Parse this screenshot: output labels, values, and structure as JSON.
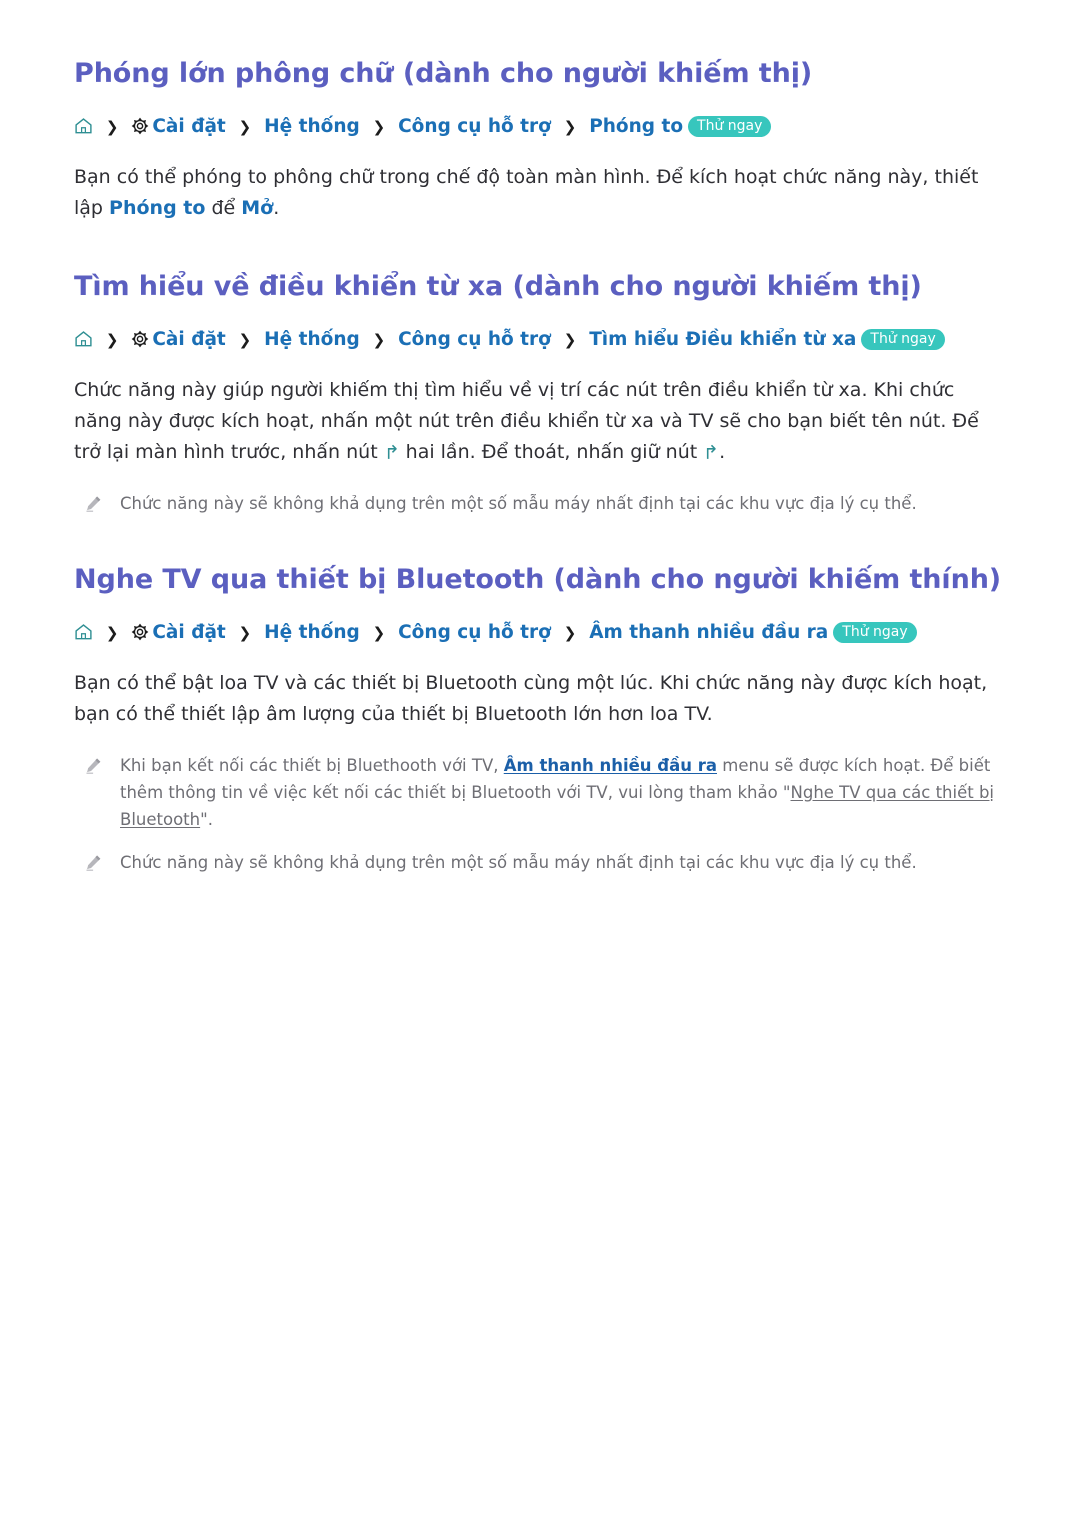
{
  "document": {
    "language": "vi",
    "accent_heading_color": "#5b5fc0",
    "link_color": "#1b6fb5",
    "badge_color": "#37c6bd",
    "note_text_color": "#6e6e74"
  },
  "sections": [
    {
      "id": "zoom-font",
      "title": "Phóng lớn phông chữ (dành cho người khiếm thị)",
      "breadcrumb": {
        "home_icon": "home-icon",
        "gear_icon": "gear-icon",
        "separator": "❯",
        "crumbs": [
          "Cài đặt",
          "Hệ thống",
          "Công cụ hỗ trợ",
          "Phóng to"
        ],
        "badge": "Thử ngay"
      },
      "body": {
        "part1": "Bạn có thể phóng to phông chữ trong chế độ toàn màn hình. Để kích hoạt chức năng này, thiết lập ",
        "link1": "Phóng to",
        "part2": " để ",
        "link2": "Mở",
        "part3": "."
      },
      "notes": []
    },
    {
      "id": "learn-remote",
      "title": "Tìm hiểu về điều khiển từ xa (dành cho người khiếm thị)",
      "breadcrumb": {
        "home_icon": "home-icon",
        "gear_icon": "gear-icon",
        "separator": "❯",
        "crumbs": [
          "Cài đặt",
          "Hệ thống",
          "Công cụ hỗ trợ",
          "Tìm hiểu Điều khiển từ xa"
        ],
        "badge": "Thử ngay"
      },
      "body": {
        "part1": "Chức năng này giúp người khiếm thị tìm hiểu về vị trí các nút trên điều khiển từ xa. Khi chức năng này được kích hoạt, nhấn một nút trên điều khiển từ xa và TV sẽ cho bạn biết tên nút. Để trở lại màn hình trước, nhấn nút ",
        "return_icon_1": "↰",
        "part2": " hai lần. Để thoát, nhấn giữ nút ",
        "return_icon_2": "↰",
        "part3": "."
      },
      "notes": [
        {
          "icon": "pencil-icon",
          "text": "Chức năng này sẽ không khả dụng trên một số mẫu máy nhất định tại các khu vực địa lý cụ thể."
        }
      ]
    },
    {
      "id": "bluetooth-audio",
      "title": "Nghe TV qua thiết bị Bluetooth (dành cho người khiếm thính)",
      "breadcrumb": {
        "home_icon": "home-icon",
        "gear_icon": "gear-icon",
        "separator": "❯",
        "crumbs": [
          "Cài đặt",
          "Hệ thống",
          "Công cụ hỗ trợ",
          "Âm thanh nhiều đầu ra"
        ],
        "badge": "Thử ngay"
      },
      "body": {
        "part1": "Bạn có thể bật loa TV và các thiết bị Bluetooth cùng một lúc. Khi chức năng này được kích hoạt, bạn có thể thiết lập âm lượng của thiết bị Bluetooth lớn hơn loa TV."
      },
      "notes": [
        {
          "icon": "pencil-icon",
          "text_part1": "Khi bạn kết nối các thiết bị Bluethooth với TV, ",
          "link_blue": "Âm thanh nhiều đầu ra",
          "text_part2": " menu sẽ được kích hoạt. Để biết thêm thông tin về việc kết nối các thiết bị Bluetooth với TV, vui lòng tham khảo \"",
          "link_gray": "Nghe TV qua các thiết bị Bluetooth",
          "text_part3": "\"."
        },
        {
          "icon": "pencil-icon",
          "text": "Chức năng này sẽ không khả dụng trên một số mẫu máy nhất định tại các khu vực địa lý cụ thể."
        }
      ]
    }
  ]
}
